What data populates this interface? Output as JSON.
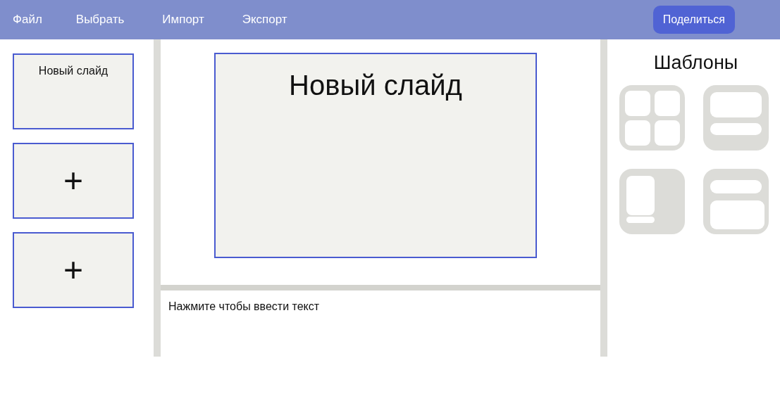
{
  "menu": {
    "items": [
      "Файл",
      "Выбрать",
      "Импорт",
      "Экспорт"
    ],
    "share_button": "Поделиться"
  },
  "slides": [
    {
      "kind": "slide",
      "title": "Новый слайд"
    },
    {
      "kind": "add",
      "symbol": "+"
    },
    {
      "kind": "add",
      "symbol": "+"
    }
  ],
  "current_slide": {
    "title": "Новый слайд"
  },
  "notes": {
    "placeholder": "Нажмите чтобы ввести текст"
  },
  "templates": {
    "title": "Шаблоны",
    "items": [
      {
        "kind": "grid"
      },
      {
        "kind": "top-bottom"
      },
      {
        "kind": "side"
      },
      {
        "kind": "rows"
      }
    ]
  }
}
